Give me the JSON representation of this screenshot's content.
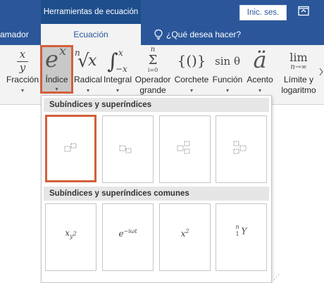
{
  "title_bar": {
    "context_tab": "Herramientas de ecuación",
    "sign_in_label": "Inic. ses."
  },
  "tabs": {
    "left_partial": "amador",
    "active": "Ecuación",
    "tell_me": "¿Qué desea hacer?"
  },
  "ribbon": {
    "items": [
      {
        "label": "Fracción",
        "icon": "fraction-icon"
      },
      {
        "label": "Índice",
        "icon": "script-icon"
      },
      {
        "label": "Radical",
        "icon": "radical-icon"
      },
      {
        "label": "Integral",
        "icon": "integral-icon"
      },
      {
        "label": "Operador",
        "label2": "grande",
        "icon": "large-operator-icon"
      },
      {
        "label": "Corchete",
        "icon": "bracket-icon"
      },
      {
        "label": "Función",
        "icon": "function-icon"
      },
      {
        "label": "Acento",
        "icon": "accent-icon"
      },
      {
        "label": "Límite y",
        "label2": "logaritmo",
        "icon": "limit-log-icon"
      }
    ],
    "glyphs": {
      "frac_num": "x",
      "frac_den": "y",
      "script_base": "e",
      "script_sup": "x",
      "radical_index": "n",
      "radical_radicand": "x",
      "int_upper": "x",
      "int_lower": "−x",
      "op_upper": "n",
      "op_symbol": "Σ",
      "op_lower": "i=0",
      "bracket": "{()}",
      "func": "sin θ",
      "accent": "ä",
      "lim_top": "lim",
      "lim_bottom": "n→∞"
    }
  },
  "popup": {
    "section1": "Subíndices y superíndices",
    "section2": "Subíndices y superíndices comunes",
    "common": {
      "f1_base": "x",
      "f1_sub": "y",
      "f1_subsup": "2",
      "f2_base": "e",
      "f2_sup": "−iωt",
      "f3_base": "x",
      "f3_sup": "2",
      "f4_pre_sup": "n",
      "f4_pre_sub": "1",
      "f4_base": "Y"
    }
  }
}
